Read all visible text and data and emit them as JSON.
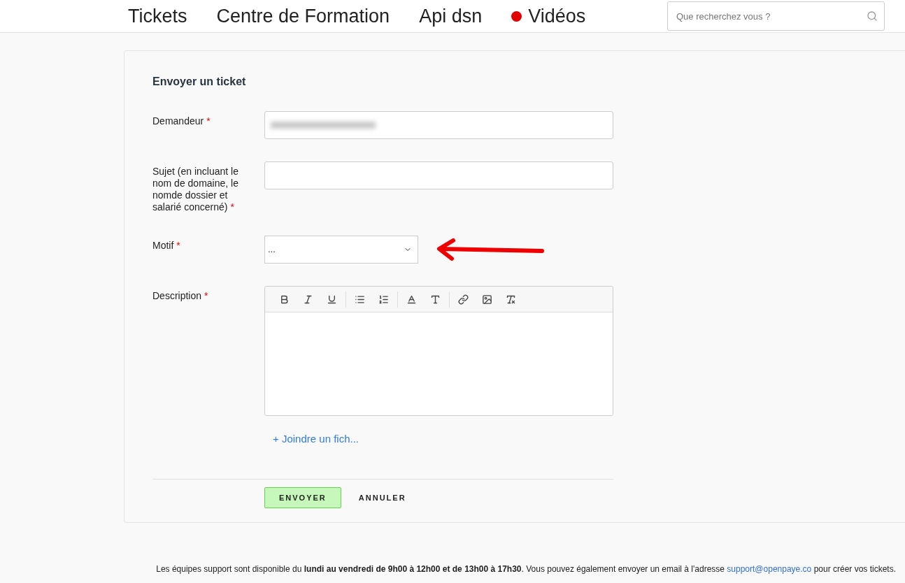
{
  "nav": {
    "items": [
      {
        "label": "Tickets",
        "live": false
      },
      {
        "label": "Centre de Formation",
        "live": false
      },
      {
        "label": "Api dsn",
        "live": false
      },
      {
        "label": "Vidéos",
        "live": true
      }
    ],
    "search": {
      "placeholder": "Que recherchez vous ?"
    }
  },
  "form": {
    "title": "Envoyer un ticket",
    "fields": [
      {
        "kind": "text",
        "label": "Demandeur",
        "required_mark": "*",
        "redacted": true
      },
      {
        "kind": "text",
        "label": "Sujet (en incluant le nom de domaine, le nomde dossier et salarié concerné)",
        "required_mark": "*",
        "redacted": false
      },
      {
        "kind": "select",
        "label": "Motif",
        "required_mark": "*",
        "value": "...",
        "annotated": true
      },
      {
        "kind": "editor",
        "label": "Description",
        "required_mark": "*"
      }
    ],
    "attach": "+ Joindre un fich...",
    "buttons": [
      {
        "label": "ENVOYER",
        "primary": true
      },
      {
        "label": "ANNULER",
        "primary": false
      }
    ]
  },
  "footer": {
    "before": "Les équipes support sont disponible du **lundi au vendredi de 9h00 à 12h00 et de 13h00 à 17h30**. Vous pouvez également envoyer un email à l'adresse",
    "link": "support@openpaye.co",
    "after": "pour créer vos tickets."
  }
}
